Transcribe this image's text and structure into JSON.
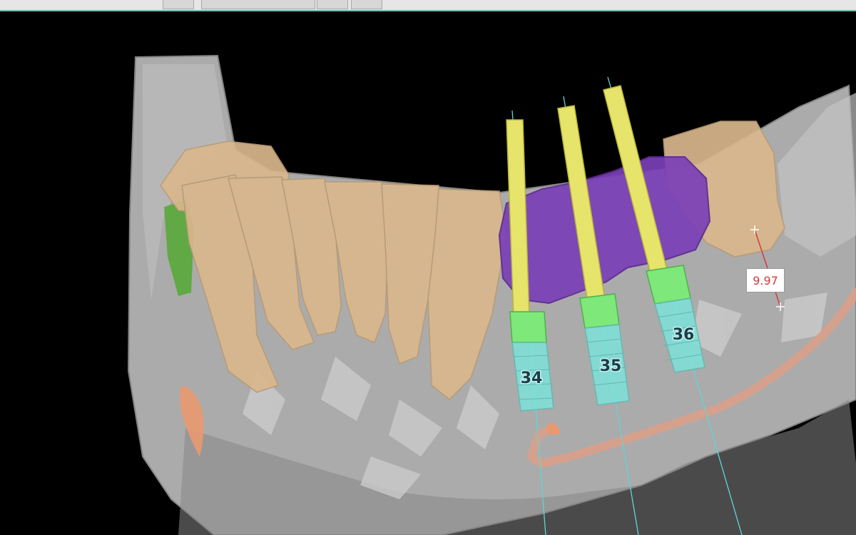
{
  "app": {
    "toolbar_buttons": [
      "",
      "",
      "",
      ""
    ]
  },
  "viewport": {
    "implants": [
      {
        "label": "34",
        "color_fixture": "#7ee3d9",
        "color_abutment": "#7ee87a",
        "color_guide": "#e6e46a"
      },
      {
        "label": "35",
        "color_fixture": "#7ee3d9",
        "color_abutment": "#7ee87a",
        "color_guide": "#e6e46a"
      },
      {
        "label": "36",
        "color_fixture": "#7ee3d9",
        "color_abutment": "#7ee87a",
        "color_guide": "#e6e46a"
      }
    ],
    "measurement": {
      "value": "9.97",
      "color": "#d43a3a"
    },
    "colors": {
      "bone": "#bfbfbf",
      "teeth": "#d9b78c",
      "bridge": "#7b3fb8",
      "nerve": "#d9a08a",
      "gum": "#58a83a"
    }
  }
}
